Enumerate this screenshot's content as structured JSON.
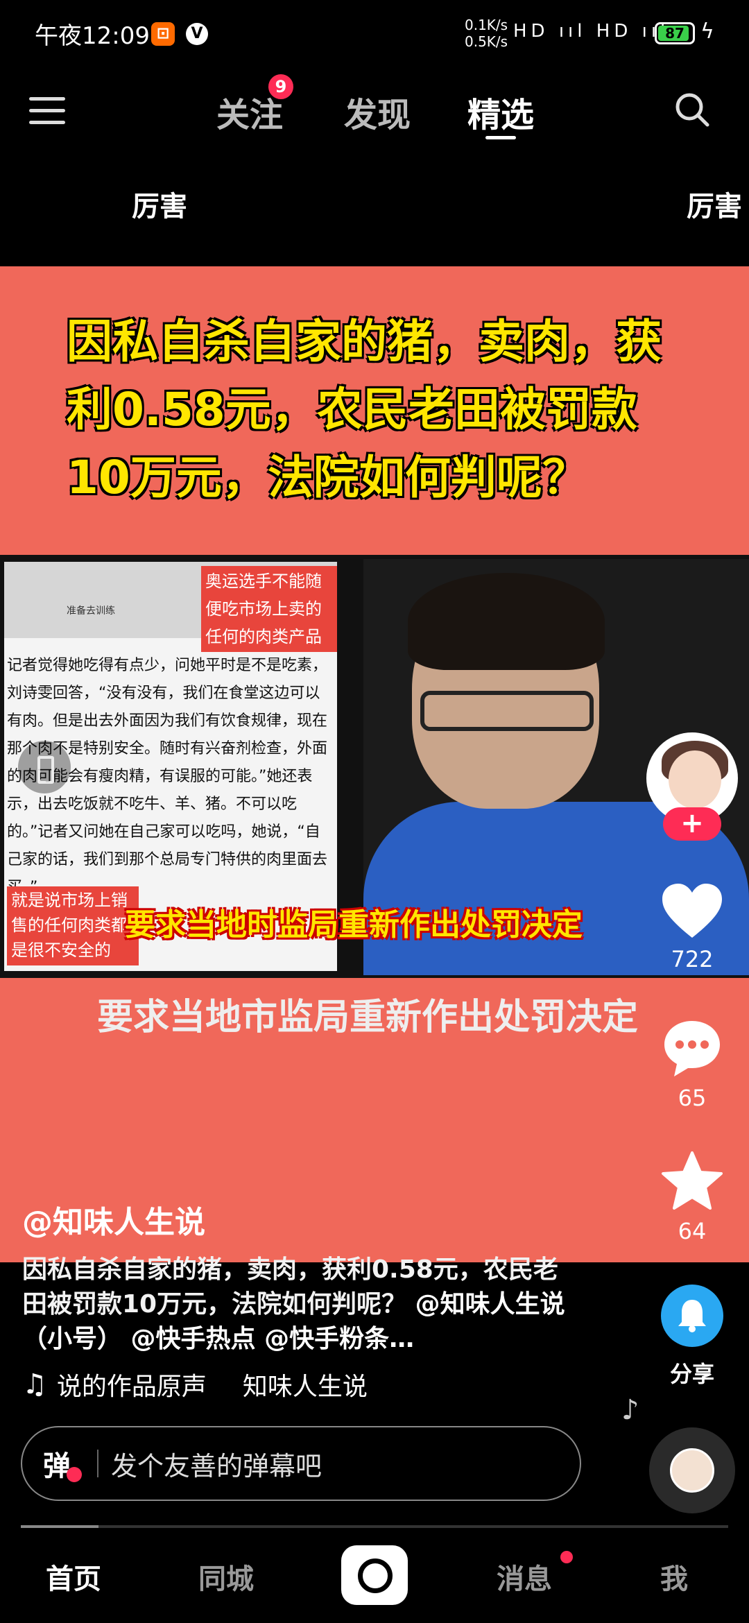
{
  "status_bar": {
    "time": "午夜12:09",
    "net_up": "0.1K/s",
    "net_down": "0.5K/s",
    "signal": "HD ııl HD ııl",
    "battery": "87"
  },
  "top_nav": {
    "tabs": [
      {
        "label": "关注",
        "badge": "9"
      },
      {
        "label": "发现"
      },
      {
        "label": "精选"
      }
    ],
    "active_tab": "精选"
  },
  "danmaku_overlay": [
    "厉害",
    "厉害"
  ],
  "video": {
    "headline": "因私自杀自家的猪，卖肉，获利0.58元，农民老田被罚款10万元，法院如何判呢？",
    "inset_note_top": "奥运选手不能随便吃市场上卖的任何的肉类产品",
    "inset_doc_text": "记者觉得她吃得有点少，问她平时是不是吃素，刘诗雯回答，“没有没有，我们在食堂这边可以有肉。但是出去外面因为我们有饮食规律，现在那个肉不是特别安全。随时有兴奋剂检查，外面的肉可能会有瘦肉精，有误服的可能。”她还表示，出去吃饭就不吃牛、羊、猪。不可以吃的。”记者又问她在自己家可以吃吗，她说，“自己家的话，我们到那个总局专门特供的肉里面去买。”",
    "inset_note_bottom": "就是说市场上销售的任何肉类都是很不安全的",
    "inset_doc_tag": "准备去训练",
    "inset_caption": "要求当地时监局重新作出处罚决定",
    "subtitle": "要求当地市监局重新作出处罚决定"
  },
  "actions": {
    "likes": "722",
    "comments": "65",
    "favorites": "64",
    "share_label": "分享",
    "follow_label": "+"
  },
  "post": {
    "author": "@知味人生说",
    "description": "因私自杀自家的猪，卖肉，获利0.58元，农民老田被罚款10万元，法院如何判呢？",
    "mentions": "@知味人生说（小号） @快手热点 @快手粉条…",
    "music_title": "说的作品原声",
    "music_artist": "知味人生说"
  },
  "danmaku_input": {
    "toggle_label": "弹",
    "placeholder": "发个友善的弹幕吧"
  },
  "progress": 0.11,
  "bottom_nav": {
    "items": [
      "首页",
      "同城",
      "消息",
      "我"
    ],
    "active": "首页"
  },
  "colors": {
    "accent": "#fe2c55",
    "video_bg": "#f0685a",
    "headline_yellow": "#ffe600",
    "share_blue": "#2aa8f2"
  }
}
